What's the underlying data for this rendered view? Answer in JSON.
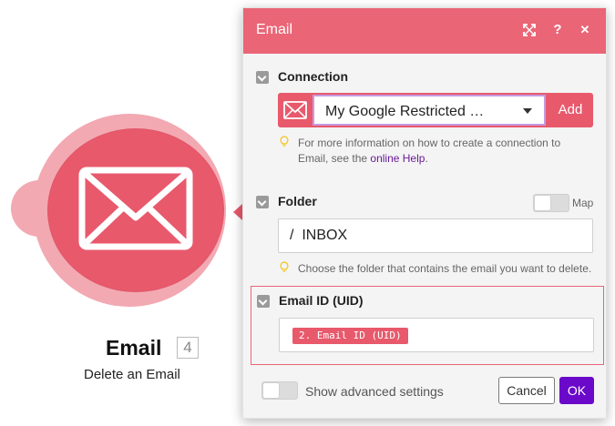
{
  "module": {
    "title": "Email",
    "badge": "4",
    "subtitle": "Delete an Email",
    "icon": "envelope-icon",
    "color": "#e8596c"
  },
  "dialog": {
    "title": "Email",
    "header_color": "#ea6576",
    "header_buttons": [
      "expand-icon",
      "help-icon",
      "close-icon"
    ],
    "help_glyph": "?",
    "close_glyph": "✕"
  },
  "connection": {
    "label": "Connection",
    "selected": "My Google Restricted …",
    "add_label": "Add",
    "hint_prefix": "For more information on how to create a connection to Email, see the",
    "hint_link": "online Help",
    "hint_suffix": "."
  },
  "folder": {
    "label": "Folder",
    "map_label": "Map",
    "slash": "/",
    "value": "INBOX",
    "hint": "Choose the folder that contains the email you want to delete."
  },
  "email_id": {
    "label": "Email ID (UID)",
    "token": "2. Email ID (UID)"
  },
  "footer": {
    "advanced_label": "Show advanced settings",
    "cancel_label": "Cancel",
    "ok_label": "OK",
    "ok_color": "#6a09c9"
  }
}
